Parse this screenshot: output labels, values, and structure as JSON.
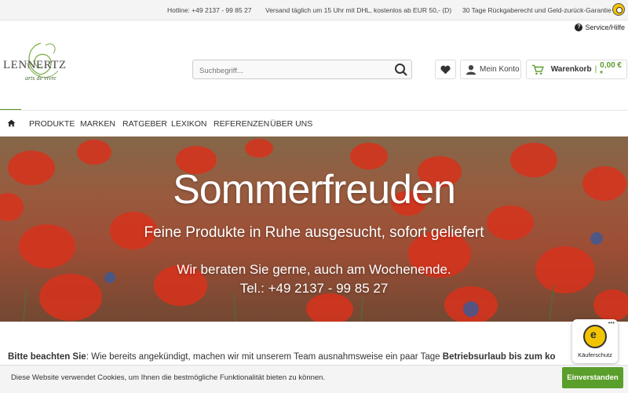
{
  "topbar": {
    "hotline": "Hotline: +49 2137 - 99 85 27",
    "shipping": "Versand täglich um 15 Uhr mit DHL, kostenlos ab EUR 50,- (D)",
    "guarantee": "30 Tage Rückgaberecht und Geld-zurück-Garantie"
  },
  "service": {
    "label": "Service/Hilfe"
  },
  "logo": {
    "name": "LENNERTZ",
    "tagline": "arts de vivre"
  },
  "search": {
    "placeholder": "Suchbegriff..."
  },
  "header": {
    "account_label": "Mein Konto",
    "cart_label": "Warenkorb",
    "cart_total": "0,00 € *"
  },
  "nav": {
    "items": [
      "PRODUKTE",
      "MARKEN",
      "RATGEBER",
      "LEXIKON",
      "REFERENZEN",
      "ÜBER UNS"
    ]
  },
  "hero": {
    "headline": "Sommerfreuden",
    "subline": "Feine Produkte in Ruhe ausgesucht, sofort geliefert",
    "line3": "Wir beraten Sie gerne, auch am Wochenende.",
    "line4": "Tel.: +49 2137 - 99 85 27"
  },
  "notice": {
    "lead": "Bitte beachten Sie",
    "text": ": Wie bereits angekündigt, machen wir mit unserem Team ausnahmsweise ein paar Tage ",
    "bold_tail": "Betriebsurlaub bis zum ko"
  },
  "trust_widget": {
    "label": "Käuferschutz",
    "menu": "•••"
  },
  "cookie": {
    "text": "Diese Website verwendet Cookies, um Ihnen die bestmögliche Funktionalität bieten zu können.",
    "accept_label": "Einverstanden"
  },
  "colors": {
    "accent": "#5a9e2b",
    "cart_price": "#5a9e2b"
  }
}
